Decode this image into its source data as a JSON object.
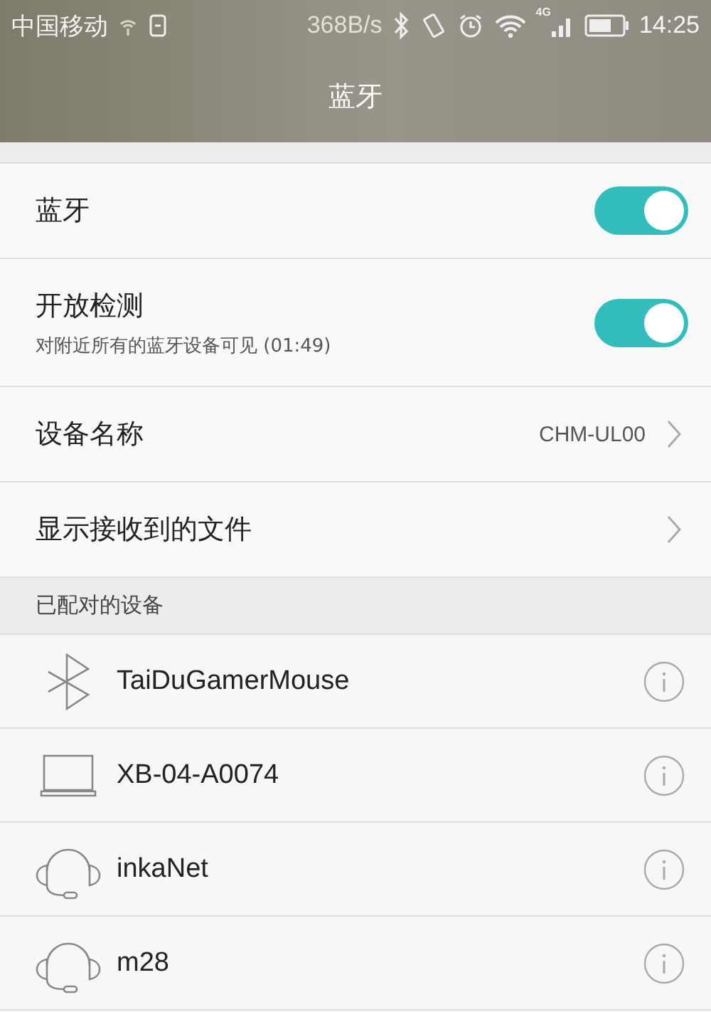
{
  "status_bar": {
    "carrier": "中国移动",
    "speed": "368B/s",
    "network": "4G",
    "time": "14:25"
  },
  "header": {
    "title": "蓝牙"
  },
  "settings": [
    {
      "kind": "toggle",
      "label": "蓝牙",
      "on": true
    },
    {
      "kind": "toggle",
      "label": "开放检测",
      "subtitle": "对附近所有的蓝牙设备可见 (01:49)",
      "on": true
    },
    {
      "kind": "link",
      "label": "设备名称",
      "value": "CHM-UL00"
    },
    {
      "kind": "link",
      "label": "显示接收到的文件"
    }
  ],
  "paired_section": {
    "title": "已配对的设备"
  },
  "devices": [
    {
      "kind": "bluetooth",
      "name": "TaiDuGamerMouse"
    },
    {
      "kind": "laptop",
      "name": "XB-04-A0074"
    },
    {
      "kind": "headset",
      "name": "inkaNet"
    },
    {
      "kind": "headset",
      "name": "m28"
    }
  ]
}
